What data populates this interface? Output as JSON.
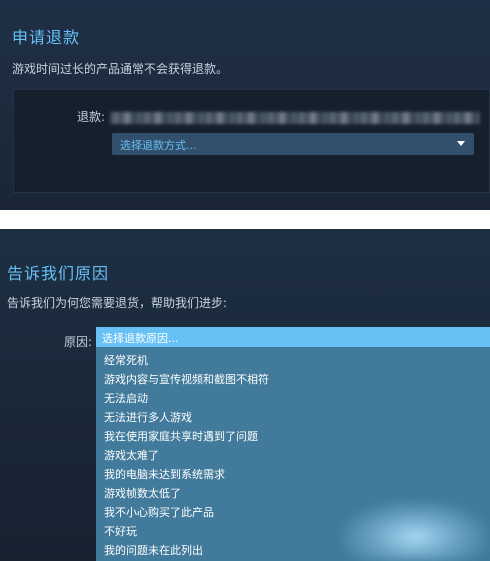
{
  "refund_panel": {
    "title": "申请退款",
    "subtitle": "游戏时间过长的产品通常不会获得退款。",
    "refund_label": "退款:",
    "select_placeholder": "选择退款方式..."
  },
  "reason_panel": {
    "title": "告诉我们原因",
    "subtitle": "告诉我们为何您需要退货，帮助我们进步:",
    "reason_label": "原因:",
    "dropdown_header": "选择退款原因...",
    "options": [
      "经常死机",
      "游戏内容与宣传视频和截图不相符",
      "无法启动",
      "无法进行多人游戏",
      "我在使用家庭共享时遇到了问题",
      "游戏太难了",
      "我的电脑未达到系统需求",
      "游戏帧数太低了",
      "我不小心购买了此产品",
      "不好玩",
      "我的问题未在此列出"
    ]
  },
  "colors": {
    "panel_bg": "#1b2838",
    "accent": "#67c1f5",
    "dropdown_bg": "#417a9b"
  }
}
